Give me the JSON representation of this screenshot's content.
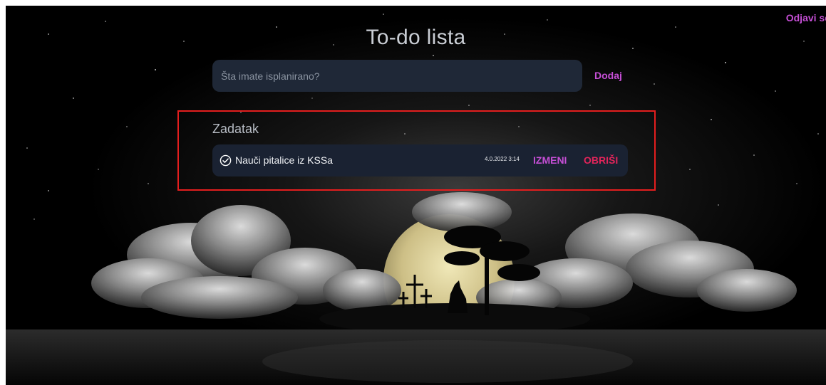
{
  "header": {
    "logout_label": "Odjavi se",
    "title": "To-do lista"
  },
  "new_task": {
    "placeholder": "Šta imate isplanirano?",
    "add_label": "Dodaj"
  },
  "task_section": {
    "heading": "Zadatak",
    "tasks": [
      {
        "text": "Nauči pitalice iz KSSa",
        "date": "4.0.2022 3:14",
        "edit_label": "IZMENI",
        "delete_label": "OBRIŠI",
        "status_icon": "check-circle-icon"
      }
    ]
  },
  "colors": {
    "accent": "#c64fd6",
    "danger": "#e2245a",
    "highlight_border": "#e41e1e",
    "panel": "#1f2837"
  }
}
